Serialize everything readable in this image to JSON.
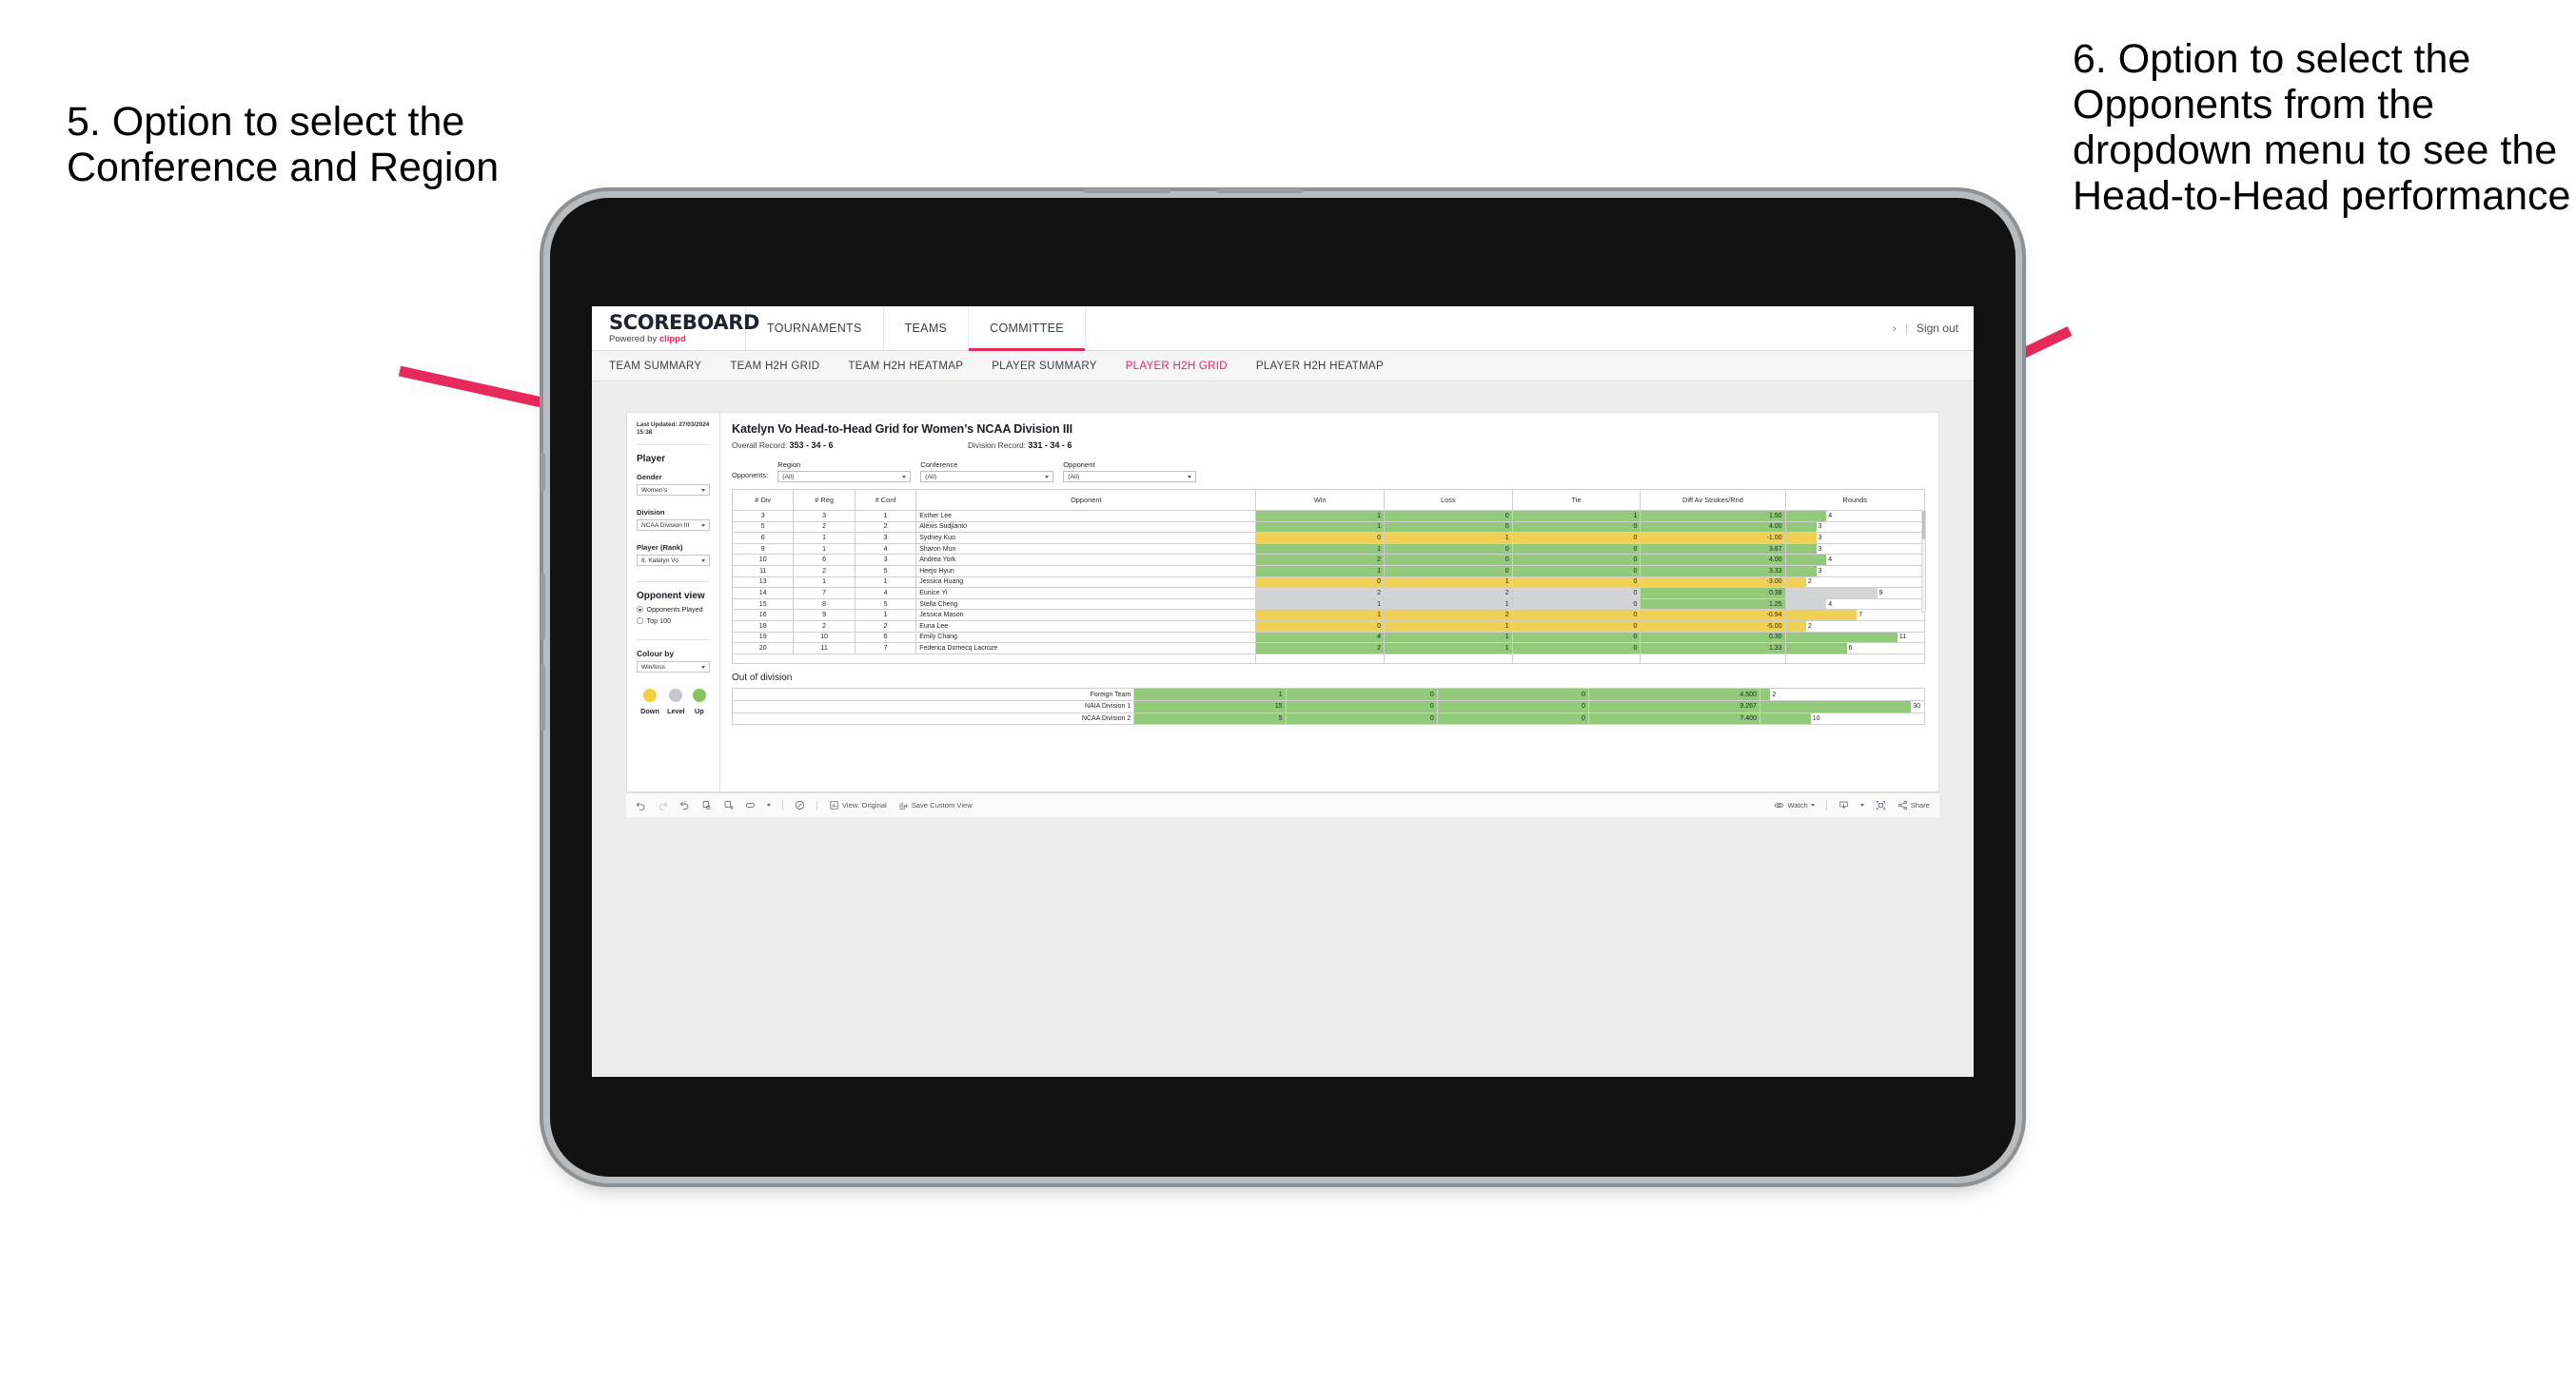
{
  "annotations": {
    "left": "5. Option to select the Conference and Region",
    "right": "6. Option to select the Opponents from the dropdown menu to see the Head-to-Head performance"
  },
  "app": {
    "logo": {
      "main": "SCOREBOARD",
      "powered": "Powered by",
      "brand": "clippd"
    },
    "nav": [
      {
        "label": "TOURNAMENTS",
        "active": false
      },
      {
        "label": "TEAMS",
        "active": false
      },
      {
        "label": "COMMITTEE",
        "active": true
      }
    ],
    "header_right": {
      "chevron": "›",
      "divider": "|",
      "sign_out": "Sign out"
    },
    "subnav": [
      {
        "label": "TEAM SUMMARY",
        "active": false
      },
      {
        "label": "TEAM H2H GRID",
        "active": false
      },
      {
        "label": "TEAM H2H HEATMAP",
        "active": false
      },
      {
        "label": "PLAYER SUMMARY",
        "active": false
      },
      {
        "label": "PLAYER H2H GRID",
        "active": true
      },
      {
        "label": "PLAYER H2H HEATMAP",
        "active": false
      }
    ]
  },
  "sidebar": {
    "last_updated": "Last Updated: 27/03/2024 15:38",
    "player_heading": "Player",
    "gender": {
      "label": "Gender",
      "value": "Women’s"
    },
    "division": {
      "label": "Division",
      "value": "NCAA Division III"
    },
    "player_rank": {
      "label": "Player (Rank)",
      "value": "8. Katelyn Vo"
    },
    "opponent_view": {
      "heading": "Opponent view",
      "options": [
        {
          "label": "Opponents Played",
          "selected": true
        },
        {
          "label": "Top 100",
          "selected": false
        }
      ]
    },
    "colour_by": {
      "label": "Colour by",
      "value": "Win/loss"
    },
    "legend": [
      {
        "label": "Down",
        "color": "#f2cf3f"
      },
      {
        "label": "Level",
        "color": "#c3c7cb"
      },
      {
        "label": "Up",
        "color": "#85c75b"
      }
    ]
  },
  "main": {
    "title": "Katelyn Vo Head-to-Head Grid for Women’s NCAA Division III",
    "overall_record": {
      "label": "Overall Record:",
      "value": "353 - 34 - 6"
    },
    "division_record": {
      "label": "Division Record:",
      "value": "331 - 34 - 6"
    },
    "opponents_label": "Opponents:",
    "filters": [
      {
        "label": "Region",
        "value": "(All)"
      },
      {
        "label": "Conference",
        "value": "(All)"
      },
      {
        "label": "Opponent",
        "value": "(All)"
      }
    ],
    "columns": [
      "# Div",
      "# Reg",
      "# Conf",
      "Opponent",
      "Win",
      "Loss",
      "Tie",
      "Diff Av Strokes/Rnd",
      "Rounds"
    ],
    "rows": [
      {
        "div": "3",
        "reg": "3",
        "conf": "1",
        "opponent": "Esther Lee",
        "win": "1",
        "loss": "0",
        "tie": "1",
        "diff": "1.50",
        "rounds": "4",
        "status": "up"
      },
      {
        "div": "5",
        "reg": "2",
        "conf": "2",
        "opponent": "Alexis Sudjianto",
        "win": "1",
        "loss": "0",
        "tie": "0",
        "diff": "4.00",
        "rounds": "3",
        "status": "up"
      },
      {
        "div": "6",
        "reg": "1",
        "conf": "3",
        "opponent": "Sydney Kuo",
        "win": "0",
        "loss": "1",
        "tie": "0",
        "diff": "-1.00",
        "rounds": "3",
        "status": "down"
      },
      {
        "div": "9",
        "reg": "1",
        "conf": "4",
        "opponent": "Sharon Mun",
        "win": "1",
        "loss": "0",
        "tie": "0",
        "diff": "3.67",
        "rounds": "3",
        "status": "up"
      },
      {
        "div": "10",
        "reg": "6",
        "conf": "3",
        "opponent": "Andrea York",
        "win": "2",
        "loss": "0",
        "tie": "0",
        "diff": "4.00",
        "rounds": "4",
        "status": "up"
      },
      {
        "div": "11",
        "reg": "2",
        "conf": "5",
        "opponent": "Heejo Hyun",
        "win": "1",
        "loss": "0",
        "tie": "0",
        "diff": "3.33",
        "rounds": "3",
        "status": "up"
      },
      {
        "div": "13",
        "reg": "1",
        "conf": "1",
        "opponent": "Jessica Huang",
        "win": "0",
        "loss": "1",
        "tie": "0",
        "diff": "-3.00",
        "rounds": "2",
        "status": "down"
      },
      {
        "div": "14",
        "reg": "7",
        "conf": "4",
        "opponent": "Eunice Yi",
        "win": "2",
        "loss": "2",
        "tie": "0",
        "diff": "0.38",
        "rounds": "9",
        "status": "level"
      },
      {
        "div": "15",
        "reg": "8",
        "conf": "5",
        "opponent": "Stella Cheng",
        "win": "1",
        "loss": "1",
        "tie": "0",
        "diff": "1.25",
        "rounds": "4",
        "status": "level"
      },
      {
        "div": "16",
        "reg": "9",
        "conf": "1",
        "opponent": "Jessica Mason",
        "win": "1",
        "loss": "2",
        "tie": "0",
        "diff": "-0.94",
        "rounds": "7",
        "status": "down"
      },
      {
        "div": "18",
        "reg": "2",
        "conf": "2",
        "opponent": "Euna Lee",
        "win": "0",
        "loss": "1",
        "tie": "0",
        "diff": "-5.00",
        "rounds": "2",
        "status": "down"
      },
      {
        "div": "19",
        "reg": "10",
        "conf": "6",
        "opponent": "Emily Chang",
        "win": "4",
        "loss": "1",
        "tie": "0",
        "diff": "0.30",
        "rounds": "11",
        "status": "up"
      },
      {
        "div": "20",
        "reg": "11",
        "conf": "7",
        "opponent": "Federica Domecq Lacroze",
        "win": "2",
        "loss": "1",
        "tie": "0",
        "diff": "1.33",
        "rounds": "6",
        "status": "up"
      }
    ],
    "out_of_division": {
      "title": "Out of division",
      "rows": [
        {
          "name": "Foreign Team",
          "win": "1",
          "loss": "0",
          "tie": "0",
          "diff": "4.500",
          "rounds": "2",
          "status": "up"
        },
        {
          "name": "NAIA Division 1",
          "win": "15",
          "loss": "0",
          "tie": "0",
          "diff": "9.267",
          "rounds": "30",
          "status": "up"
        },
        {
          "name": "NCAA Division 2",
          "win": "5",
          "loss": "0",
          "tie": "0",
          "diff": "7.400",
          "rounds": "10",
          "status": "up"
        }
      ]
    }
  },
  "toolbar": {
    "view_label": "View: Original",
    "save_label": "Save Custom View",
    "watch_label": "Watch",
    "share_label": "Share"
  },
  "colors": {
    "accent": "#e8295c",
    "up": "#92c97a",
    "down": "#f0d055",
    "level": "#d2d4d6"
  },
  "chart_data": {
    "type": "table",
    "title": "Katelyn Vo Head-to-Head Grid for Women’s NCAA Division III",
    "columns": [
      "# Div",
      "# Reg",
      "# Conf",
      "Opponent",
      "Win",
      "Loss",
      "Tie",
      "Diff Av Strokes/Rnd",
      "Rounds"
    ],
    "rows": [
      [
        "3",
        "3",
        "1",
        "Esther Lee",
        1,
        0,
        1,
        1.5,
        4
      ],
      [
        "5",
        "2",
        "2",
        "Alexis Sudjianto",
        1,
        0,
        0,
        4.0,
        3
      ],
      [
        "6",
        "1",
        "3",
        "Sydney Kuo",
        0,
        1,
        0,
        -1.0,
        3
      ],
      [
        "9",
        "1",
        "4",
        "Sharon Mun",
        1,
        0,
        0,
        3.67,
        3
      ],
      [
        "10",
        "6",
        "3",
        "Andrea York",
        2,
        0,
        0,
        4.0,
        4
      ],
      [
        "11",
        "2",
        "5",
        "Heejo Hyun",
        1,
        0,
        0,
        3.33,
        3
      ],
      [
        "13",
        "1",
        "1",
        "Jessica Huang",
        0,
        1,
        0,
        -3.0,
        2
      ],
      [
        "14",
        "7",
        "4",
        "Eunice Yi",
        2,
        2,
        0,
        0.38,
        9
      ],
      [
        "15",
        "8",
        "5",
        "Stella Cheng",
        1,
        1,
        0,
        1.25,
        4
      ],
      [
        "16",
        "9",
        "1",
        "Jessica Mason",
        1,
        2,
        0,
        -0.94,
        7
      ],
      [
        "18",
        "2",
        "2",
        "Euna Lee",
        0,
        1,
        0,
        -5.0,
        2
      ],
      [
        "19",
        "10",
        "6",
        "Emily Chang",
        4,
        1,
        0,
        0.3,
        11
      ],
      [
        "20",
        "11",
        "7",
        "Federica Domecq Lacroze",
        2,
        1,
        0,
        1.33,
        6
      ]
    ],
    "out_of_division_rows": [
      [
        "Foreign Team",
        1,
        0,
        0,
        4.5,
        2
      ],
      [
        "NAIA Division 1",
        15,
        0,
        0,
        9.267,
        30
      ],
      [
        "NCAA Division 2",
        5,
        0,
        0,
        7.4,
        10
      ]
    ],
    "rounds_max": 30,
    "legend": [
      "Down",
      "Level",
      "Up"
    ]
  }
}
